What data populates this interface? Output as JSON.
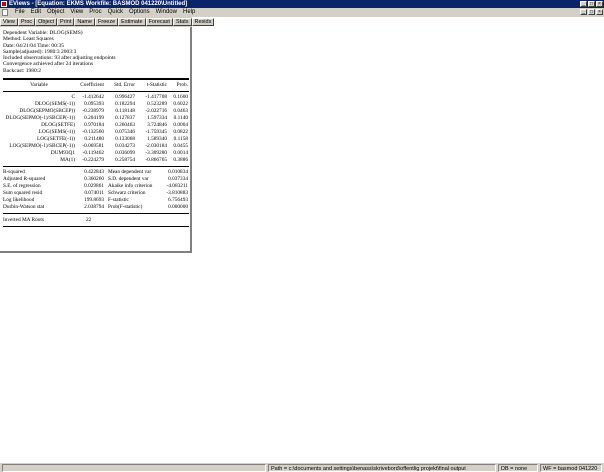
{
  "window": {
    "title": "EViews - [Equation: EKMS   Workfile: BASMOD 041220\\Untitled]",
    "controls": [
      "_",
      "□",
      "×"
    ]
  },
  "menu": {
    "items": [
      "File",
      "Edit",
      "Object",
      "View",
      "Proc",
      "Quick",
      "Options",
      "Window",
      "Help"
    ]
  },
  "equation_toolbar": {
    "buttons": [
      "View",
      "Proc",
      "Object",
      "Print",
      "Name",
      "Freeze",
      "Estimate",
      "Forecast",
      "Stats",
      "Resids"
    ]
  },
  "output": {
    "header": [
      "Dependent Variable: DLOG(SEMS)",
      "Method: Least Squares",
      "Date: 04/21/04   Time: 00:35",
      "Sample(adjusted): 1980:3 2003:3",
      "Included observations: 93 after adjusting endpoints",
      "Convergence achieved after 24 iterations",
      "Backcast: 1980:2"
    ],
    "columns": [
      "Variable",
      "Coefficient",
      "Std. Error",
      "t-Statistic",
      "Prob."
    ],
    "rows": [
      [
        "C",
        "-1.412642",
        "0.996427",
        "-1.417708",
        "0.1600"
      ],
      [
        "DLOG(SEMS(-1))",
        "0.095393",
        "0.182294",
        "0.523289",
        "0.6022"
      ],
      [
        "DLOG(SEPMO(SBCEP))",
        "-0.238979",
        "0.118148",
        "-2.022716",
        "0.0463"
      ],
      [
        "DLOG(SEPMO(-1)/SBCEP(-1))",
        "0.204199",
        "0.127837",
        "1.597334",
        "0.1140"
      ],
      [
        "DLOG(SETFE)",
        "0.970184",
        "0.260463",
        "3.724846",
        "0.0004"
      ],
      [
        "LOG(SEMS(-1))",
        "-0.132560",
        "0.075346",
        "-1.759345",
        "0.0822"
      ],
      [
        "LOG(SETFE(-1))",
        "0.211480",
        "0.133068",
        "1.589340",
        "0.1158"
      ],
      [
        "LOG(SEPMO(-1)/SBCEP(-1))",
        "-0.069581",
        "0.034273",
        "-2.030184",
        "0.0455"
      ],
      [
        "DUM93Q1",
        "-0.119462",
        "0.036099",
        "-3.309280",
        "0.0014"
      ],
      [
        "MA(1)",
        "-0.224279",
        "0.258754",
        "-0.866765",
        "0.3886"
      ]
    ],
    "stats": [
      [
        "R-squared",
        "0.422843",
        "Mean dependent var",
        "0.010834"
      ],
      [
        "Adjusted R-squared",
        "0.360260",
        "S.D. dependent var",
        "0.037334"
      ],
      [
        "S.E. of regression",
        "0.029861",
        "Akaike info criterion",
        "-4.083211"
      ],
      [
        "Sum squared resid",
        "0.074011",
        "Schwarz criterion",
        "-3.810883"
      ],
      [
        "Log likelihood",
        "199.8693",
        "F-statistic",
        "6.756493"
      ],
      [
        "Durbin-Watson stat",
        "2.038794",
        "Prob(F-statistic)",
        "0.000000"
      ]
    ],
    "roots_label": "Inverted MA Roots",
    "roots_value": "22"
  },
  "statusbar": {
    "main": "",
    "path": "Path = c:\\documents and settings\\benass\\skrivebord\\offentlig projekt\\final output",
    "db": "DB = none",
    "wf": "WF = basmod 041220"
  }
}
